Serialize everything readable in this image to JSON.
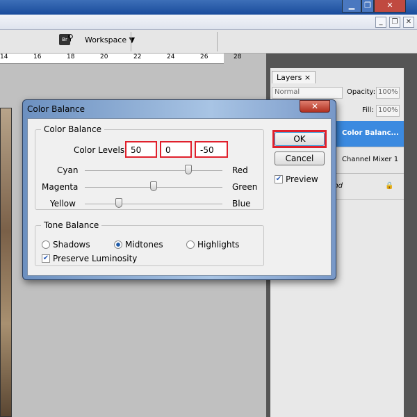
{
  "app": {
    "workspace_label": "Workspace",
    "bridge_icon": "Br"
  },
  "ruler": {
    "ticks": [
      "14",
      "16",
      "18",
      "20",
      "22",
      "24",
      "26",
      "28"
    ]
  },
  "layers_panel": {
    "tab": "Layers",
    "blend_mode": "Normal",
    "opacity_label": "Opacity:",
    "opacity": "100%",
    "fill_label": "Fill:",
    "fill": "100%",
    "layers": [
      {
        "name": "Color Balanc...",
        "selected": true
      },
      {
        "name": "Channel Mixer 1"
      },
      {
        "name": "und"
      }
    ]
  },
  "dialog": {
    "title": "Color Balance",
    "group_label": "Color Balance",
    "levels_label": "Color Levels:",
    "levels": [
      "50",
      "0",
      "-50"
    ],
    "sliders": [
      {
        "left": "Cyan",
        "right": "Red",
        "value": 50
      },
      {
        "left": "Magenta",
        "right": "Green",
        "value": 0
      },
      {
        "left": "Yellow",
        "right": "Blue",
        "value": -50
      }
    ],
    "tone_label": "Tone Balance",
    "tones": [
      "Shadows",
      "Midtones",
      "Highlights"
    ],
    "tone_selected": "Midtones",
    "preserve_label": "Preserve Luminosity",
    "preserve_checked": true,
    "ok": "OK",
    "cancel": "Cancel",
    "preview_label": "Preview",
    "preview_checked": true,
    "highlight_color": "#e0202c"
  }
}
